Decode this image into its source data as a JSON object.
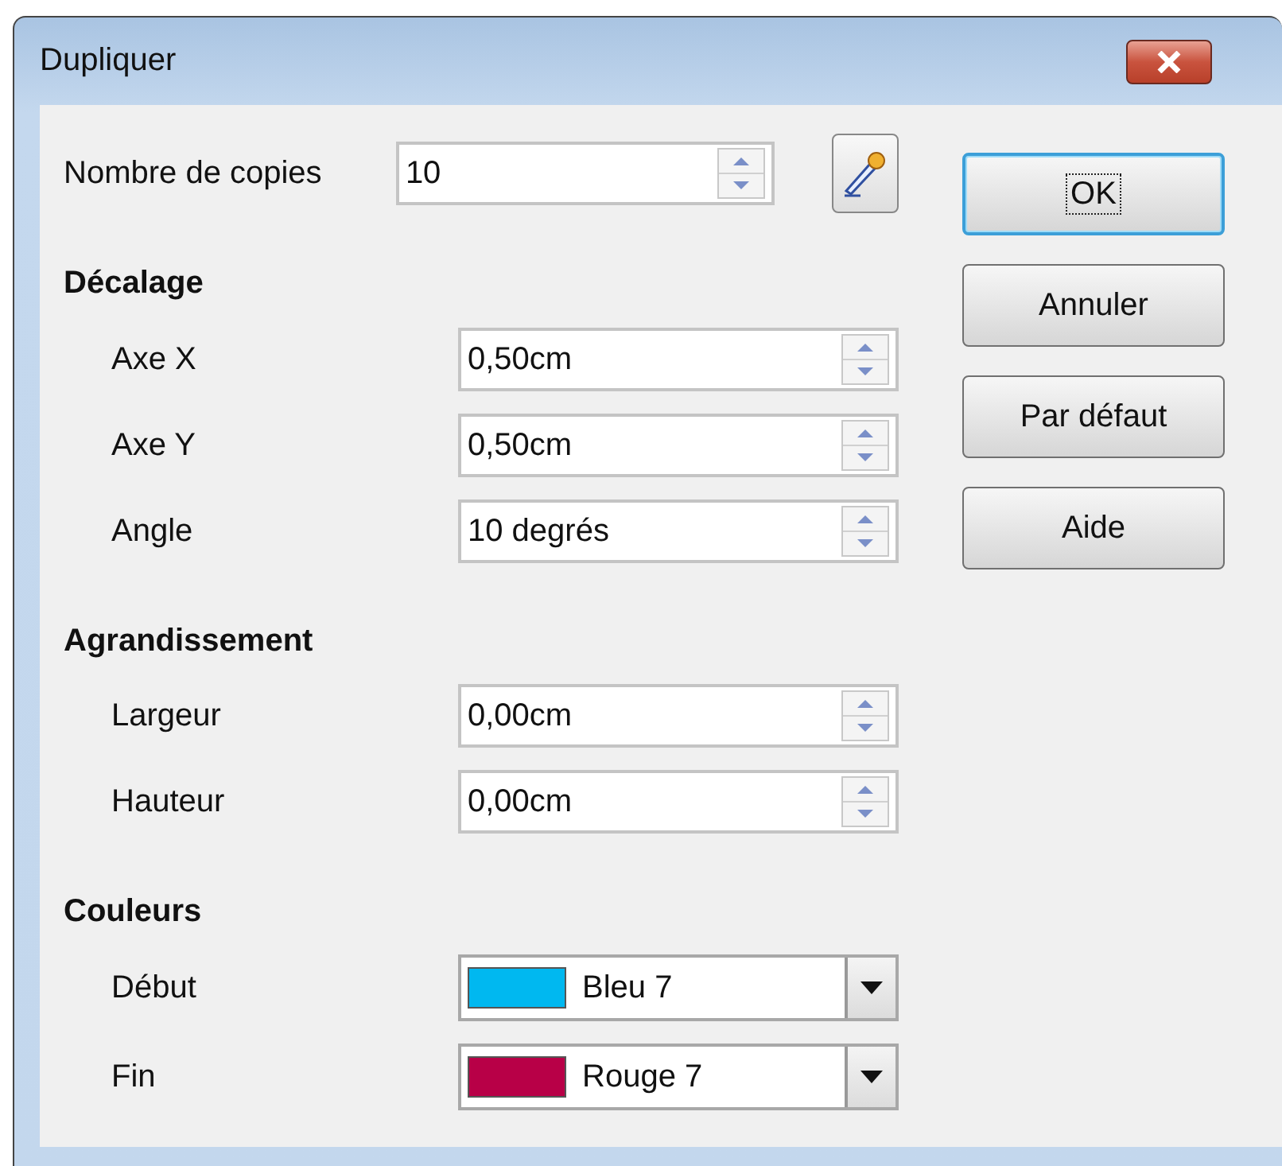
{
  "window": {
    "title": "Dupliquer"
  },
  "copies": {
    "label": "Nombre de copies",
    "value": "10"
  },
  "sections": [
    {
      "heading": "Décalage",
      "fields": [
        {
          "kind": "spin",
          "label": "Axe X",
          "value": "0,50cm"
        },
        {
          "kind": "spin",
          "label": "Axe Y",
          "value": "0,50cm"
        },
        {
          "kind": "spin",
          "label": "Angle",
          "value": "10 degrés"
        }
      ]
    },
    {
      "heading": "Agrandissement",
      "fields": [
        {
          "kind": "spin",
          "label": "Largeur",
          "value": "0,00cm"
        },
        {
          "kind": "spin",
          "label": "Hauteur",
          "value": "0,00cm"
        }
      ]
    },
    {
      "heading": "Couleurs",
      "fields": [
        {
          "kind": "color",
          "label": "Début",
          "value": "Bleu 7",
          "color": "#00b8f0"
        },
        {
          "kind": "color",
          "label": "Fin",
          "value": "Rouge 7",
          "color": "#b80047"
        }
      ]
    }
  ],
  "buttons": [
    {
      "label": "OK",
      "default": true
    },
    {
      "label": "Annuler",
      "default": false
    },
    {
      "label": "Par défaut",
      "default": false
    },
    {
      "label": "Aide",
      "default": false
    }
  ]
}
